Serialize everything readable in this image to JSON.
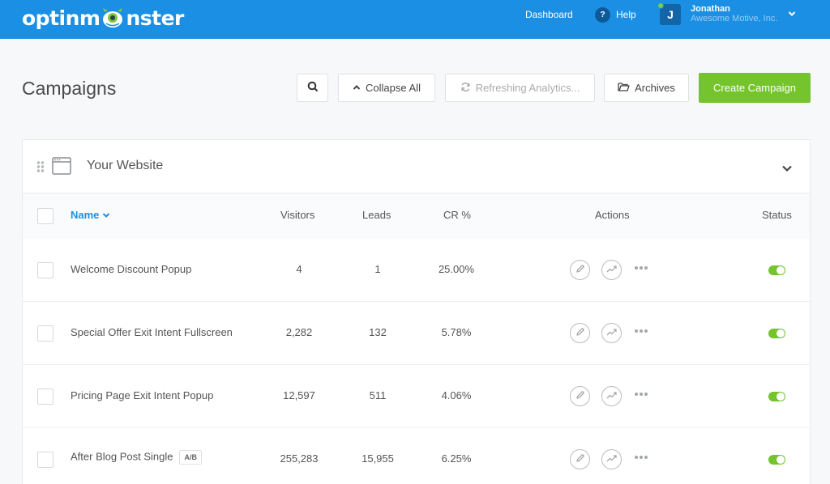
{
  "app": {
    "logo_text_left": "optinm",
    "logo_text_right": "nster"
  },
  "topbar": {
    "dashboard": "Dashboard",
    "help_icon": "?",
    "help": "Help",
    "avatar_initial": "J",
    "user_name": "Jonathan",
    "user_org": "Awesome Motive, Inc."
  },
  "header": {
    "title": "Campaigns",
    "collapse_all": "Collapse All",
    "refreshing": "Refreshing Analytics...",
    "archives": "Archives",
    "create_campaign": "Create Campaign"
  },
  "site": {
    "name": "Your Website"
  },
  "table": {
    "columns": {
      "name": "Name",
      "visitors": "Visitors",
      "leads": "Leads",
      "cr": "CR %",
      "actions": "Actions",
      "status": "Status"
    },
    "rows": [
      {
        "name": "Welcome Discount Popup",
        "badge": "",
        "visitors": "4",
        "leads": "1",
        "cr": "25.00%",
        "active": true
      },
      {
        "name": "Special Offer Exit Intent Fullscreen",
        "badge": "",
        "visitors": "2,282",
        "leads": "132",
        "cr": "5.78%",
        "active": true
      },
      {
        "name": "Pricing Page Exit Intent Popup",
        "badge": "",
        "visitors": "12,597",
        "leads": "511",
        "cr": "4.06%",
        "active": true
      },
      {
        "name": "After Blog Post Single",
        "badge": "A/B",
        "visitors": "255,283",
        "leads": "15,955",
        "cr": "6.25%",
        "active": true
      }
    ]
  },
  "colors": {
    "brand_blue": "#1a8fe3",
    "create_green": "#75c42e",
    "toggle_on": "#75c42e"
  },
  "icons": {
    "search": "search-icon",
    "collapse": "chevron-up-icon",
    "refresh": "refresh-icon",
    "archive": "folder-icon",
    "edit": "pencil-icon",
    "analytics": "trend-line-icon",
    "more": "ellipsis-icon"
  }
}
